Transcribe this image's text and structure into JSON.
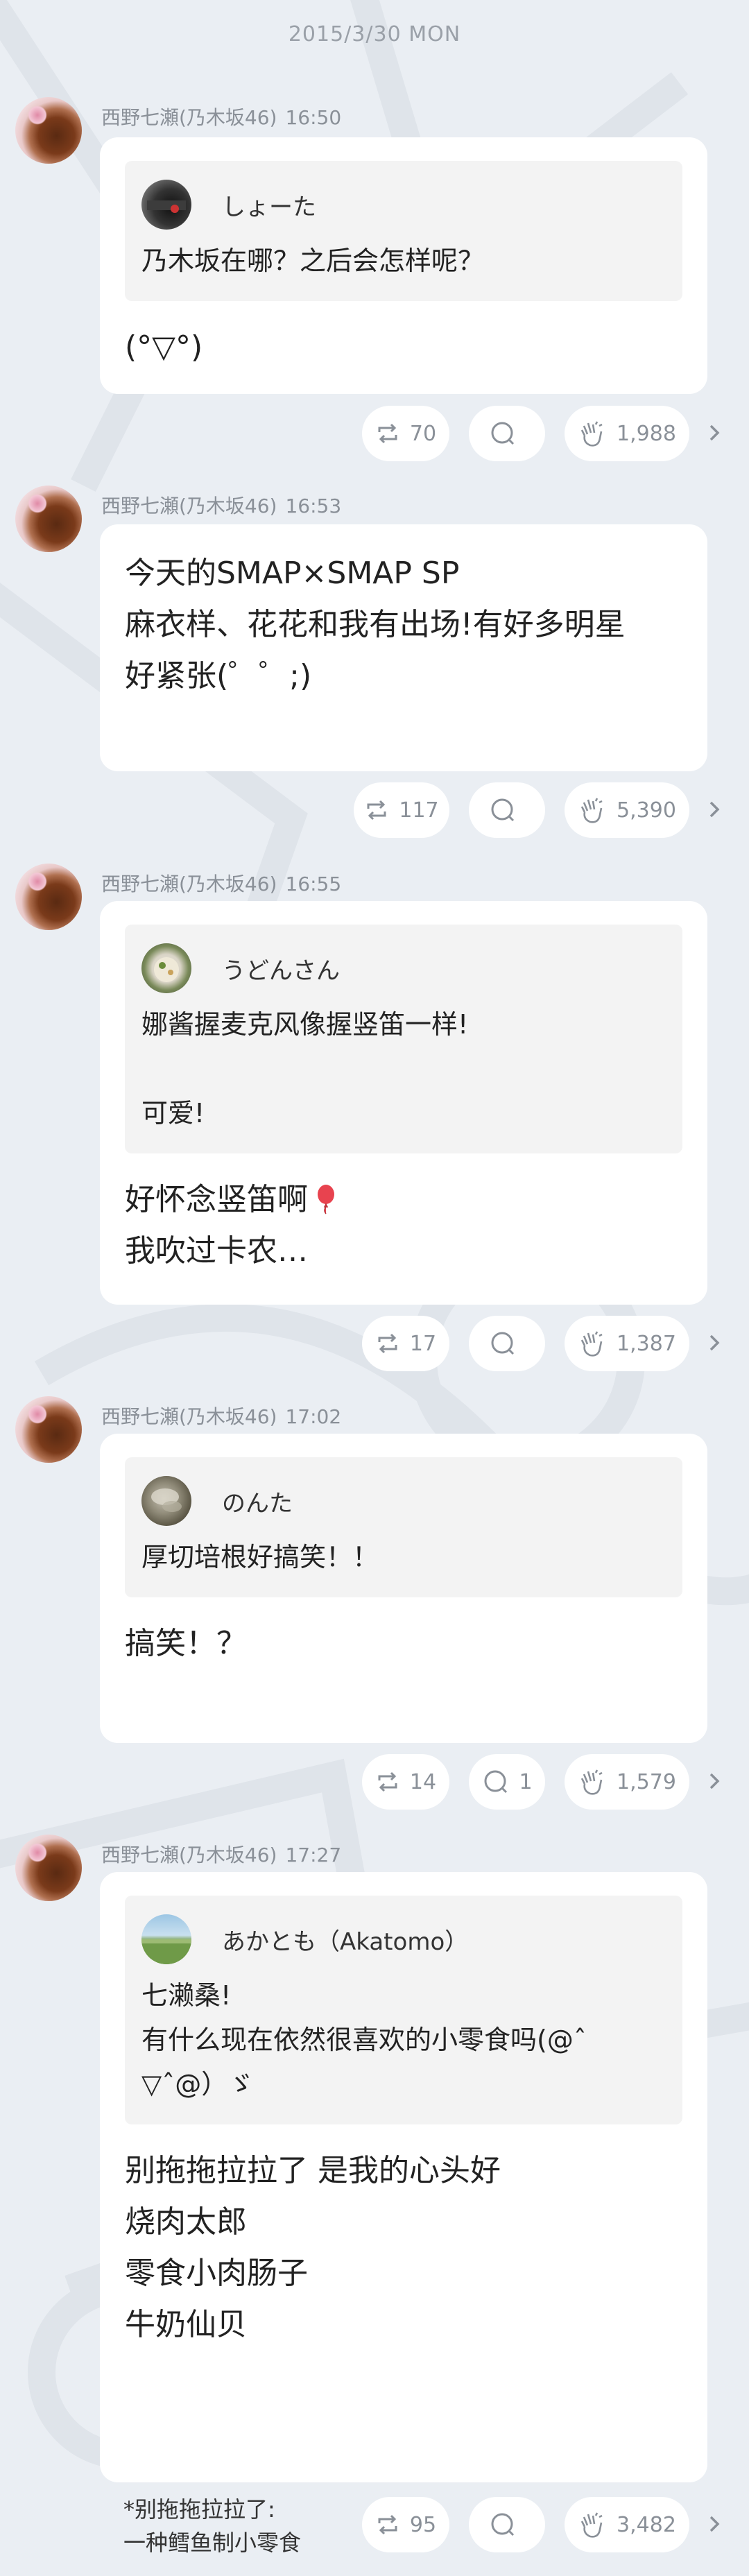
{
  "date_header": "2015/3/30 MON",
  "colors": {
    "background": "#eaeef3",
    "bubble": "#ffffff",
    "quote": "#f3f3f3",
    "meta": "#8a9098"
  },
  "posts": [
    {
      "author": "西野七瀬(乃木坂46)",
      "time": "16:50",
      "quote": {
        "name": "しょーた",
        "text": "乃木坂在哪？之后会怎样呢？",
        "avatar_icon": "dark-avatar"
      },
      "text": "(°▽°)",
      "reposts": "70",
      "comments": "",
      "claps": "1,988"
    },
    {
      "author": "西野七瀬(乃木坂46)",
      "time": "16:53",
      "quote": null,
      "text": "今天的SMAP×SMAP SP\n麻衣样、花花和我有出场!有好多明星\n好紧张(゜゜;)",
      "reposts": "117",
      "comments": "",
      "claps": "5,390"
    },
    {
      "author": "西野七瀬(乃木坂46)",
      "time": "16:55",
      "quote": {
        "name": "うどんさん",
        "text": "娜酱握麦克风像握竖笛一样!\n\n可爱!",
        "avatar_icon": "food-avatar"
      },
      "text": "好怀念竖笛啊\n我吹过卡农…",
      "reposts": "17",
      "comments": "",
      "claps": "1,387"
    },
    {
      "author": "西野七瀬(乃木坂46)",
      "time": "17:02",
      "quote": {
        "name": "のんた",
        "text": "厚切培根好搞笑！！",
        "avatar_icon": "smoke-avatar"
      },
      "text": "搞笑！？",
      "reposts": "14",
      "comments": "1",
      "claps": "1,579"
    },
    {
      "author": "西野七瀬(乃木坂46)",
      "time": "17:27",
      "quote": {
        "name": "あかとも（Akatomo）",
        "text": "七濑桑!\n有什么现在依然很喜欢的小零食吗(@ˆ\n▽ˆ@）ゞ",
        "avatar_icon": "landscape-avatar"
      },
      "text": "别拖拖拉拉了 是我的心头好\n烧肉太郎\n零食小肉肠子\n牛奶仙贝",
      "reposts": "95",
      "comments": "",
      "claps": "3,482"
    }
  ],
  "footnote": "*别拖拖拉拉了:\n一种鳕鱼制小零食"
}
